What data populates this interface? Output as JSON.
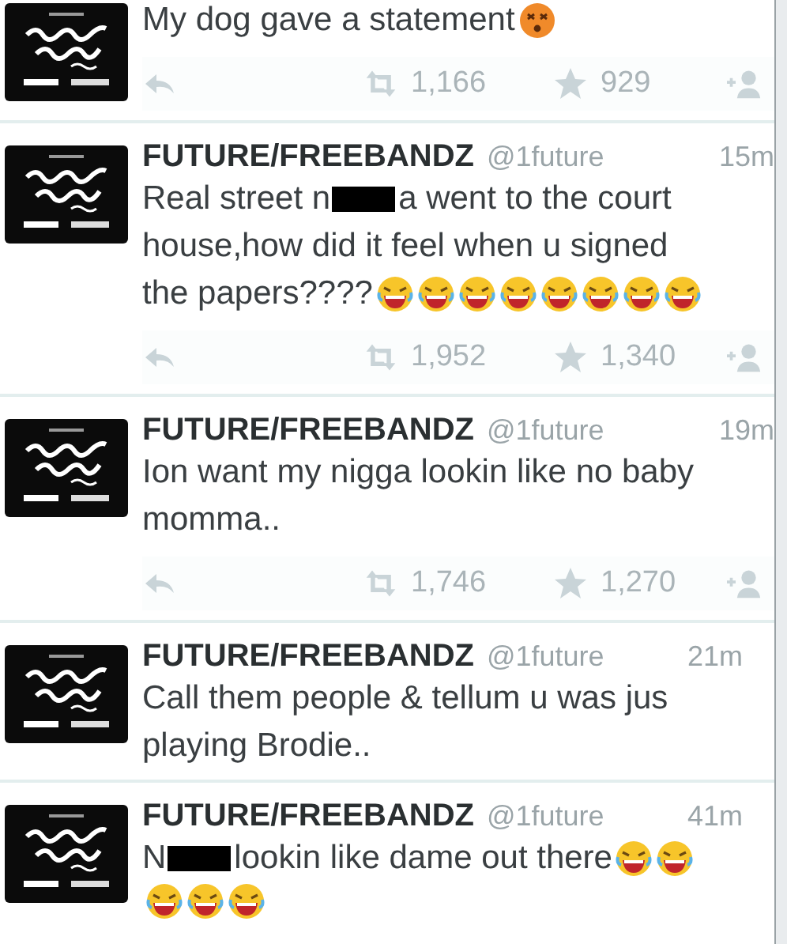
{
  "tweets": [
    {
      "lines": [
        [
          {
            "kind": "text",
            "text": "My dog gave a statement"
          },
          {
            "kind": "dizzy"
          }
        ]
      ],
      "actions": {
        "retweets": "1,166",
        "favorites": "929"
      }
    },
    {
      "header": {
        "name": "FUTURE/FREEBANDZ",
        "handle": "@1future",
        "time": "15m"
      },
      "lines": [
        [
          {
            "kind": "text",
            "text": "Real street n"
          },
          {
            "kind": "censor"
          },
          {
            "kind": "text",
            "text": "a went to the court"
          }
        ],
        [
          {
            "kind": "text",
            "text": "house,how did it feel when u signed"
          }
        ],
        [
          {
            "kind": "text",
            "text": "the papers????"
          },
          {
            "kind": "laugh"
          },
          {
            "kind": "laugh"
          },
          {
            "kind": "laugh"
          },
          {
            "kind": "laugh"
          },
          {
            "kind": "laugh"
          },
          {
            "kind": "laugh"
          },
          {
            "kind": "laugh"
          },
          {
            "kind": "laugh"
          }
        ]
      ],
      "actions": {
        "retweets": "1,952",
        "favorites": "1,340"
      }
    },
    {
      "header": {
        "name": "FUTURE/FREEBANDZ",
        "handle": "@1future",
        "time": "19m"
      },
      "lines": [
        [
          {
            "kind": "text",
            "text": "Ion want my nigga lookin like no baby"
          }
        ],
        [
          {
            "kind": "text",
            "text": "momma.."
          }
        ]
      ],
      "actions": {
        "retweets": "1,746",
        "favorites": "1,270"
      }
    },
    {
      "header": {
        "name": "FUTURE/FREEBANDZ",
        "handle": "@1future",
        "time": "21m"
      },
      "lines": [
        [
          {
            "kind": "text",
            "text": "Call them people & tellum u was jus"
          }
        ],
        [
          {
            "kind": "text",
            "text": "playing Brodie.."
          }
        ]
      ]
    },
    {
      "header": {
        "name": "FUTURE/FREEBANDZ",
        "handle": "@1future",
        "time": "41m"
      },
      "lines": [
        [
          {
            "kind": "text",
            "text": "N"
          },
          {
            "kind": "censor"
          },
          {
            "kind": "text",
            "text": "lookin like dame out there"
          },
          {
            "kind": "laugh"
          },
          {
            "kind": "laugh"
          }
        ],
        [
          {
            "kind": "laugh"
          },
          {
            "kind": "laugh"
          },
          {
            "kind": "laugh"
          }
        ]
      ]
    }
  ]
}
